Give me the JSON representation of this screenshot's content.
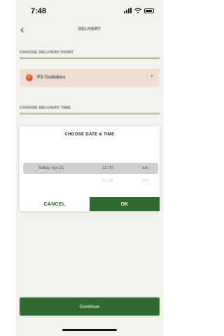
{
  "status_bar": {
    "time": "7:48"
  },
  "header": {
    "back_glyph": "‹",
    "title": "DELIVERY"
  },
  "delivery_point": {
    "section_label": "CHOOSE DELIVERY POINT",
    "selected": "P3 Outtakes",
    "check_glyph": "✓",
    "caret_glyph": "▼"
  },
  "delivery_time": {
    "section_label": "CHOOSE DELIVERY TIME"
  },
  "dialog": {
    "title": "CHOOSE DATE & TIME",
    "selected_row": {
      "date": "Today Apr.21",
      "time": "11:00",
      "ampm": "am"
    },
    "next_row": {
      "date": "",
      "time": "11:30",
      "ampm": "pm"
    },
    "cancel_label": "CANCEL",
    "ok_label": "OK"
  },
  "footer": {
    "continue_label": "Continue"
  },
  "colors": {
    "brand_green": "#2d6a2c",
    "accent_orange": "#d85f2a",
    "card_bg": "#efdcd5"
  }
}
